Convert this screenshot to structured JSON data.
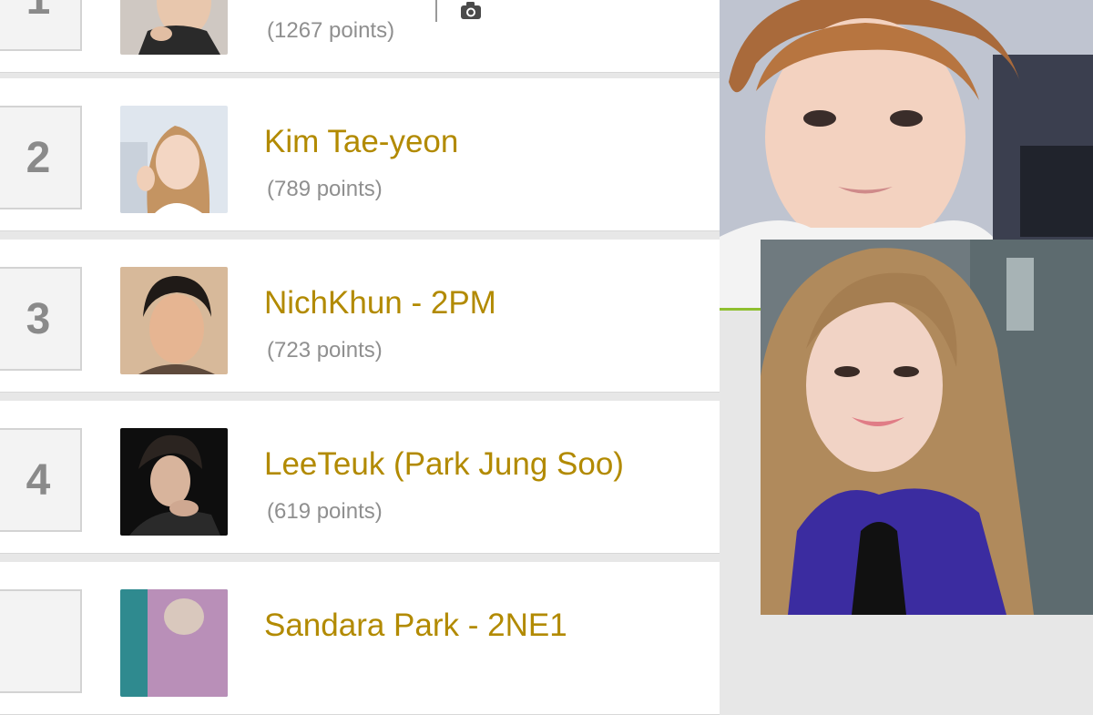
{
  "ranking": [
    {
      "rank": "1",
      "name": "",
      "points": "(1267 points)"
    },
    {
      "rank": "2",
      "name": "Kim Tae-yeon",
      "points": "(789 points)"
    },
    {
      "rank": "3",
      "name": "NichKhun - 2PM",
      "points": "(723 points)"
    },
    {
      "rank": "4",
      "name": "LeeTeuk (Park Jung Soo)",
      "points": "(619 points)"
    },
    {
      "rank": "",
      "name": "Sandara Park - 2NE1",
      "points": ""
    }
  ],
  "colors": {
    "name_link": "#b28a00",
    "points_text": "#8f8f8f",
    "rank_number": "#8a8a8a",
    "accent_line": "#8fbf2f"
  },
  "icons": [
    "camera-icon"
  ]
}
